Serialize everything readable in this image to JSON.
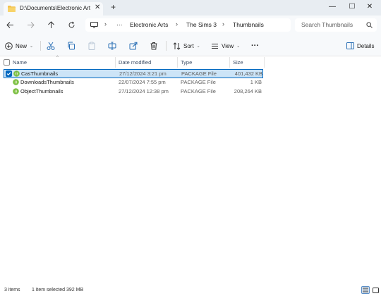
{
  "window": {
    "tab_title": "D:\\Documents\\Electronic Arts\\",
    "tab_close": "✕",
    "new_tab": "+",
    "minimize": "—",
    "maximize": "☐",
    "close": "✕"
  },
  "address": {
    "breadcrumb_ellipsis": "⋯",
    "crumbs": [
      "Electronic Arts",
      "The Sims 3",
      "Thumbnails"
    ],
    "separator": "›",
    "search_placeholder": "Search Thumbnails"
  },
  "toolbar": {
    "new_label": "New",
    "sort_label": "Sort",
    "view_label": "View",
    "more_label": "···",
    "details_label": "Details"
  },
  "columns": {
    "name": "Name",
    "date": "Date modified",
    "type": "Type",
    "size": "Size"
  },
  "files": [
    {
      "name": "CasThumbnails",
      "date": "27/12/2024 3:21 pm",
      "type": "PACKAGE File",
      "size": "401,432 KB",
      "selected": true
    },
    {
      "name": "DownloadsThumbnails",
      "date": "22/07/2024 7:55 pm",
      "type": "PACKAGE File",
      "size": "1 KB",
      "selected": false
    },
    {
      "name": "ObjectThumbnails",
      "date": "27/12/2024 12:38 pm",
      "type": "PACKAGE File",
      "size": "208,264 KB",
      "selected": false
    }
  ],
  "status": {
    "items_count": "3 items",
    "selection": "1 item selected  392 MB"
  },
  "colors": {
    "accent": "#0067c0",
    "selection_bg": "#cce4f7",
    "folder": "#f2c04b",
    "file_icon_green": "#7cc242"
  },
  "icons": {
    "file": "sims-package-icon",
    "folder": "folder-icon"
  }
}
